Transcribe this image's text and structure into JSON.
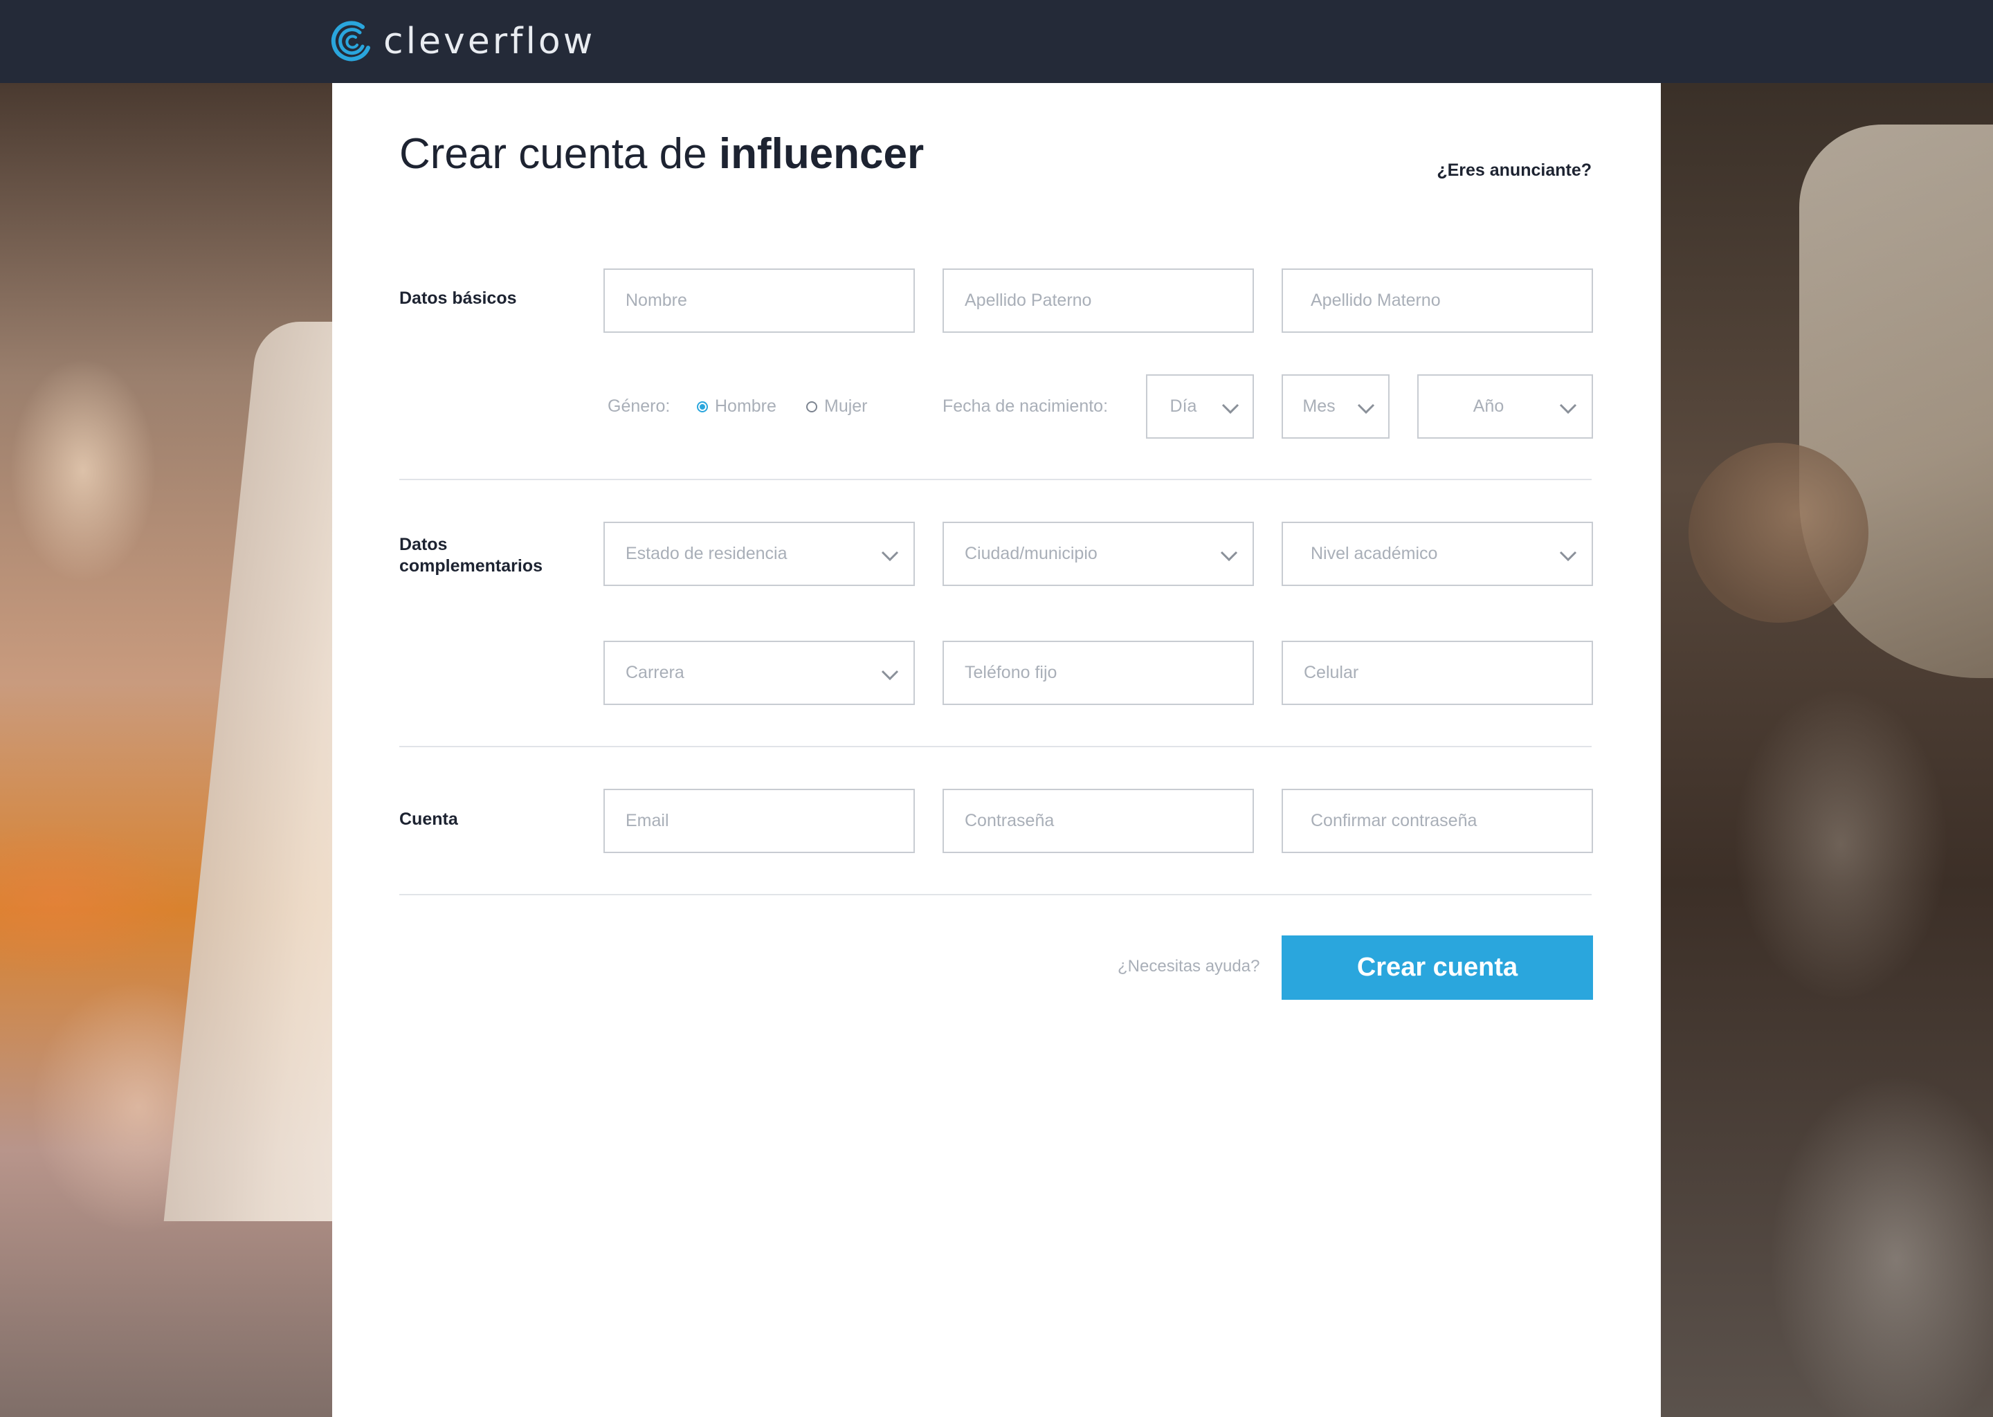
{
  "header": {
    "brand_name": "cleverflow",
    "logo_icon": "swirl-logo-icon",
    "brand_color": "#2aa6dd",
    "bar_color": "#242a38"
  },
  "page": {
    "title_prefix": "Crear cuenta de",
    "title_bold": "influencer",
    "advertiser_link": "¿Eres anunciante?"
  },
  "sections": {
    "basic": {
      "label": "Datos básicos",
      "nombre_placeholder": "Nombre",
      "apellido_paterno_placeholder": "Apellido Paterno",
      "apellido_materno_placeholder": "Apellido Materno",
      "gender_label": "Género:",
      "gender_options": [
        "Hombre",
        "Mujer"
      ],
      "gender_selected": "Hombre",
      "birthdate_label": "Fecha de nacimiento:",
      "day_select": "Día",
      "month_select": "Mes",
      "year_select": "Año"
    },
    "complementary": {
      "label_line1": "Datos",
      "label_line2": "complementarios",
      "estado_select": "Estado de residencia",
      "ciudad_select": "Ciudad/municipio",
      "nivel_select": "Nivel académico",
      "carrera_select": "Carrera",
      "telefono_placeholder": "Teléfono fijo",
      "celular_placeholder": "Celular"
    },
    "account": {
      "label": "Cuenta",
      "email_placeholder": "Email",
      "password_placeholder": "Contraseña",
      "confirm_placeholder": "Confirmar contraseña"
    }
  },
  "footer": {
    "help_link": "¿Necesitas ayuda?",
    "submit_label": "Crear cuenta",
    "accent_color": "#2aa6dd"
  }
}
